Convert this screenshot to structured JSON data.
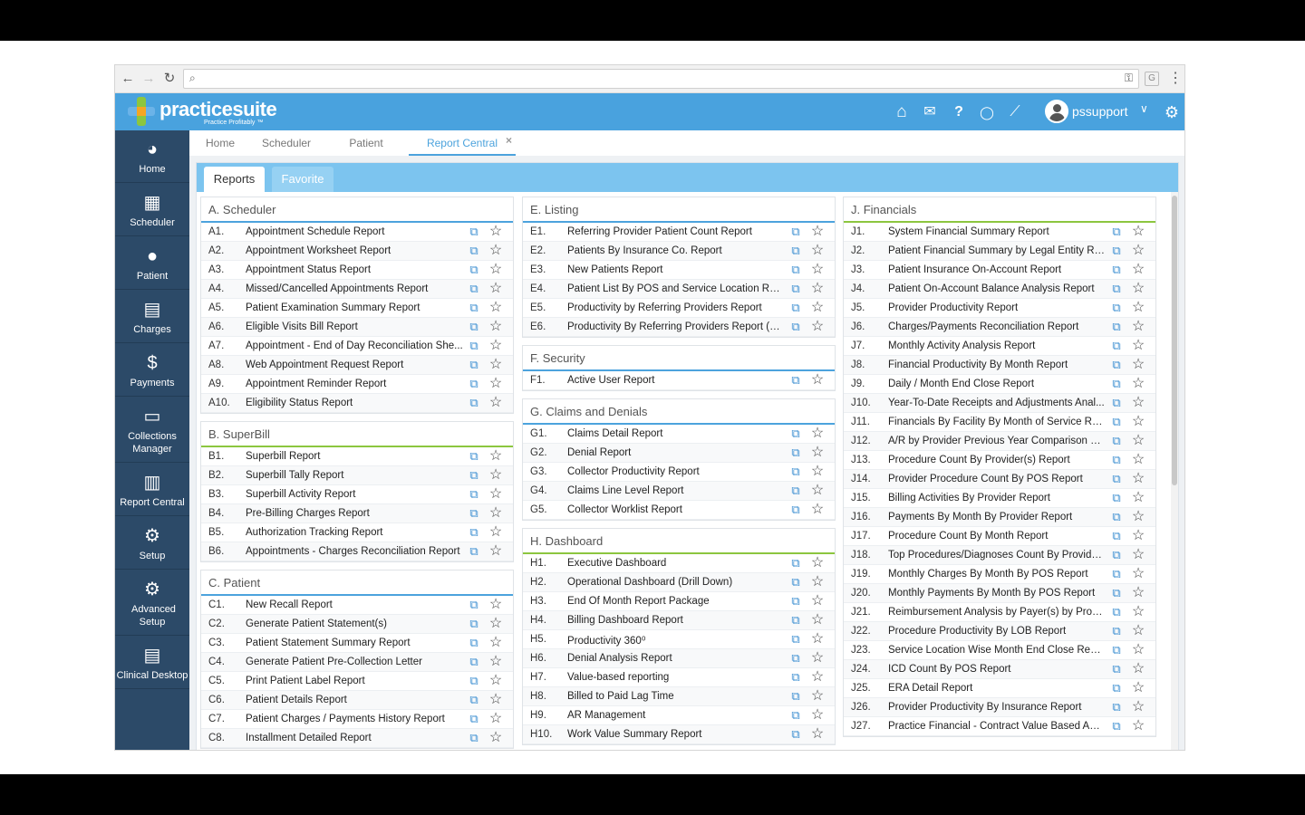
{
  "browser": {
    "back": "←",
    "forward": "→",
    "reload": "↻",
    "search_icon": "⌕",
    "key_icon": "⚿",
    "ext_label": "G",
    "menu": "⋮"
  },
  "header": {
    "logo_text": "practicesuite",
    "logo_tagline": "Practice Profitably ™",
    "username": "pssupport",
    "icons": [
      "home-icon",
      "mail-icon",
      "help-icon",
      "chat-icon",
      "ticket-icon",
      "settings-icon"
    ],
    "icon_glyphs": {
      "home": "⌂",
      "mail": "✉",
      "help": "?",
      "chat": "◯",
      "ticket": "⟋",
      "settings": "⚙",
      "chevron": "∨"
    },
    "accent_color": "#49a2de"
  },
  "sidebar": {
    "items": [
      {
        "label": "Home",
        "icon": "dashboard-icon",
        "glyph": "◕"
      },
      {
        "label": "Scheduler",
        "icon": "calendar-icon",
        "glyph": "▦"
      },
      {
        "label": "Patient",
        "icon": "person-icon",
        "glyph": "●"
      },
      {
        "label": "Charges",
        "icon": "charges-icon",
        "glyph": "▤"
      },
      {
        "label": "Payments",
        "icon": "dollar-icon",
        "glyph": "$"
      },
      {
        "label": "Collections Manager",
        "icon": "folder-icon",
        "glyph": "▭"
      },
      {
        "label": "Report Central",
        "icon": "report-icon",
        "glyph": "▥"
      },
      {
        "label": "Setup",
        "icon": "gear-icon",
        "glyph": "⚙"
      },
      {
        "label": "Advanced Setup",
        "icon": "gears-icon",
        "glyph": "⚙"
      },
      {
        "label": "Clinical Desktop",
        "icon": "clipboard-icon",
        "glyph": "▤"
      }
    ],
    "color": "#2c4a68"
  },
  "tabs": [
    {
      "label": "Home"
    },
    {
      "label": "Scheduler"
    },
    {
      "label": "Patient"
    },
    {
      "label": "Report Central",
      "active": true
    }
  ],
  "tab_close": "×",
  "subtabs": [
    {
      "label": "Reports",
      "active": true
    },
    {
      "label": "Favorite"
    }
  ],
  "row_icons": {
    "open": "⧉",
    "star": "☆"
  },
  "sections": {
    "scheduler": {
      "title": "A. Scheduler",
      "rows": [
        {
          "code": "A1.",
          "name": "Appointment Schedule Report"
        },
        {
          "code": "A2.",
          "name": "Appointment Worksheet Report"
        },
        {
          "code": "A3.",
          "name": "Appointment Status Report"
        },
        {
          "code": "A4.",
          "name": "Missed/Cancelled Appointments Report"
        },
        {
          "code": "A5.",
          "name": "Patient Examination Summary Report"
        },
        {
          "code": "A6.",
          "name": "Eligible Visits Bill Report"
        },
        {
          "code": "A7.",
          "name": "Appointment - End of Day Reconciliation She..."
        },
        {
          "code": "A8.",
          "name": "Web Appointment Request Report"
        },
        {
          "code": "A9.",
          "name": "Appointment Reminder Report"
        },
        {
          "code": "A10.",
          "name": "Eligibility Status Report"
        }
      ]
    },
    "superbill": {
      "title": "B. SuperBill",
      "rows": [
        {
          "code": "B1.",
          "name": "Superbill Report"
        },
        {
          "code": "B2.",
          "name": "Superbill Tally Report"
        },
        {
          "code": "B3.",
          "name": "Superbill Activity Report"
        },
        {
          "code": "B4.",
          "name": "Pre-Billing Charges Report"
        },
        {
          "code": "B5.",
          "name": "Authorization Tracking Report"
        },
        {
          "code": "B6.",
          "name": "Appointments - Charges Reconciliation Report"
        }
      ]
    },
    "patient": {
      "title": "C. Patient",
      "rows": [
        {
          "code": "C1.",
          "name": "New Recall Report"
        },
        {
          "code": "C2.",
          "name": "Generate Patient Statement(s)"
        },
        {
          "code": "C3.",
          "name": "Patient Statement Summary Report"
        },
        {
          "code": "C4.",
          "name": "Generate Patient Pre-Collection Letter"
        },
        {
          "code": "C5.",
          "name": "Print Patient Label Report"
        },
        {
          "code": "C6.",
          "name": "Patient Details Report"
        },
        {
          "code": "C7.",
          "name": "Patient Charges / Payments History Report"
        },
        {
          "code": "C8.",
          "name": "Installment Detailed Report"
        }
      ]
    },
    "listing": {
      "title": "E. Listing",
      "rows": [
        {
          "code": "E1.",
          "name": "Referring Provider Patient Count Report"
        },
        {
          "code": "E2.",
          "name": "Patients By Insurance Co. Report"
        },
        {
          "code": "E3.",
          "name": "New Patients Report"
        },
        {
          "code": "E4.",
          "name": "Patient List By POS and Service Location Rep..."
        },
        {
          "code": "E5.",
          "name": "Productivity by Referring Providers Report"
        },
        {
          "code": "E6.",
          "name": "Productivity By Referring Providers Report (S..."
        }
      ]
    },
    "security": {
      "title": "F. Security",
      "rows": [
        {
          "code": "F1.",
          "name": "Active User Report"
        }
      ]
    },
    "claims": {
      "title": "G. Claims and Denials",
      "rows": [
        {
          "code": "G1.",
          "name": "Claims Detail Report"
        },
        {
          "code": "G2.",
          "name": "Denial Report"
        },
        {
          "code": "G3.",
          "name": "Collector Productivity Report"
        },
        {
          "code": "G4.",
          "name": "Claims Line Level Report"
        },
        {
          "code": "G5.",
          "name": "Collector Worklist Report"
        }
      ]
    },
    "dashboard": {
      "title": "H. Dashboard",
      "rows": [
        {
          "code": "H1.",
          "name": "Executive Dashboard"
        },
        {
          "code": "H2.",
          "name": "Operational Dashboard (Drill Down)"
        },
        {
          "code": "H3.",
          "name": "End Of Month Report Package"
        },
        {
          "code": "H4.",
          "name": "Billing Dashboard Report"
        },
        {
          "code": "H5.",
          "name": "Productivity 360⁰"
        },
        {
          "code": "H6.",
          "name": "Denial Analysis Report"
        },
        {
          "code": "H7.",
          "name": "Value-based reporting"
        },
        {
          "code": "H8.",
          "name": "Billed to Paid Lag Time"
        },
        {
          "code": "H9.",
          "name": "AR Management"
        },
        {
          "code": "H10.",
          "name": "Work Value Summary Report"
        }
      ]
    },
    "financials": {
      "title": "J. Financials",
      "rows": [
        {
          "code": "J1.",
          "name": "System Financial Summary Report"
        },
        {
          "code": "J2.",
          "name": "Patient Financial Summary by Legal Entity Re..."
        },
        {
          "code": "J3.",
          "name": "Patient Insurance On-Account Report"
        },
        {
          "code": "J4.",
          "name": "Patient On-Account Balance Analysis Report"
        },
        {
          "code": "J5.",
          "name": "Provider Productivity Report"
        },
        {
          "code": "J6.",
          "name": "Charges/Payments Reconciliation Report"
        },
        {
          "code": "J7.",
          "name": "Monthly Activity Analysis Report"
        },
        {
          "code": "J8.",
          "name": "Financial Productivity By Month Report"
        },
        {
          "code": "J9.",
          "name": "Daily / Month End Close Report"
        },
        {
          "code": "J10.",
          "name": "Year-To-Date Receipts and Adjustments Anal..."
        },
        {
          "code": "J11.",
          "name": "Financials By Facility By Month of Service Rep..."
        },
        {
          "code": "J12.",
          "name": "A/R by Provider Previous Year Comparison R..."
        },
        {
          "code": "J13.",
          "name": "Procedure Count By Provider(s) Report"
        },
        {
          "code": "J14.",
          "name": "Provider Procedure Count By POS Report"
        },
        {
          "code": "J15.",
          "name": "Billing Activities By Provider Report"
        },
        {
          "code": "J16.",
          "name": "Payments By Month By Provider Report"
        },
        {
          "code": "J17.",
          "name": "Procedure Count By Month Report"
        },
        {
          "code": "J18.",
          "name": "Top Procedures/Diagnoses Count By Provide..."
        },
        {
          "code": "J19.",
          "name": "Monthly Charges By Month By POS Report"
        },
        {
          "code": "J20.",
          "name": "Monthly Payments By Month By POS Report"
        },
        {
          "code": "J21.",
          "name": "Reimbursement Analysis by Payer(s) by Proc..."
        },
        {
          "code": "J22.",
          "name": "Procedure Productivity By LOB Report"
        },
        {
          "code": "J23.",
          "name": "Service Location Wise Month End Close Report"
        },
        {
          "code": "J24.",
          "name": "ICD Count By POS Report"
        },
        {
          "code": "J25.",
          "name": "ERA Detail Report"
        },
        {
          "code": "J26.",
          "name": "Provider Productivity By Insurance Report"
        },
        {
          "code": "J27.",
          "name": "Practice Financial - Contract Value Based Ana..."
        }
      ]
    }
  }
}
